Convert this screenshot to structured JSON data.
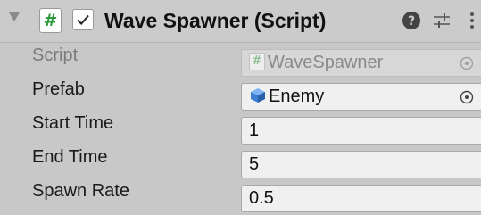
{
  "component": {
    "script_badge": "#",
    "title": "Wave Spawner (Script)",
    "enabled": true
  },
  "fields": {
    "script": {
      "label": "Script",
      "value": "WaveSpawner"
    },
    "prefab": {
      "label": "Prefab",
      "value": "Enemy"
    },
    "start_time": {
      "label": "Start Time",
      "value": "1"
    },
    "end_time": {
      "label": "End Time",
      "value": "5"
    },
    "spawn_rate": {
      "label": "Spawn Rate",
      "value": "0.5"
    }
  },
  "icons": {
    "foldout": "triangle-down-icon",
    "help": "question-circle-icon",
    "presets": "sliders-icon",
    "menu": "kebab-menu-icon",
    "script_field": "script-hash-icon",
    "prefab_field": "prefab-cube-icon",
    "object_picker": "target-circle-icon"
  },
  "colors": {
    "panel_bg": "#c8c8c8",
    "field_bg": "#f0f0f0",
    "script_badge_green": "#2e9a3e",
    "prefab_blue": "#3d7fd6"
  }
}
